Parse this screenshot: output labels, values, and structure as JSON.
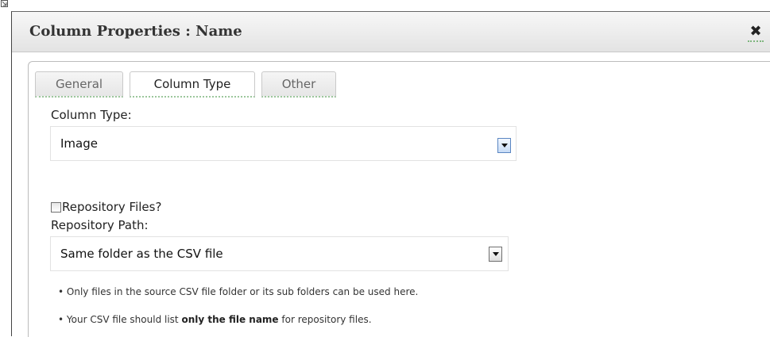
{
  "dialog": {
    "title": "Column Properties : Name",
    "close_label": "✖"
  },
  "tabs": [
    {
      "label": "General",
      "active": false
    },
    {
      "label": "Column Type",
      "active": true
    },
    {
      "label": "Other",
      "active": false
    }
  ],
  "column_type": {
    "label": "Column Type:",
    "selected": "Image"
  },
  "repository": {
    "checkbox_label": "Repository Files?",
    "checked": false,
    "path_label": "Repository Path:",
    "path_selected": "Same folder as the CSV file"
  },
  "notes": [
    {
      "text": "• Only files in the source CSV file folder or its sub folders can be used here."
    },
    {
      "prefix": "• Your CSV file should list ",
      "bold": "only the file name",
      "suffix": " for repository files."
    }
  ],
  "icons": {
    "corner": "resize-corner-icon",
    "close": "close-icon",
    "dropdown": "chevron-down-icon"
  }
}
